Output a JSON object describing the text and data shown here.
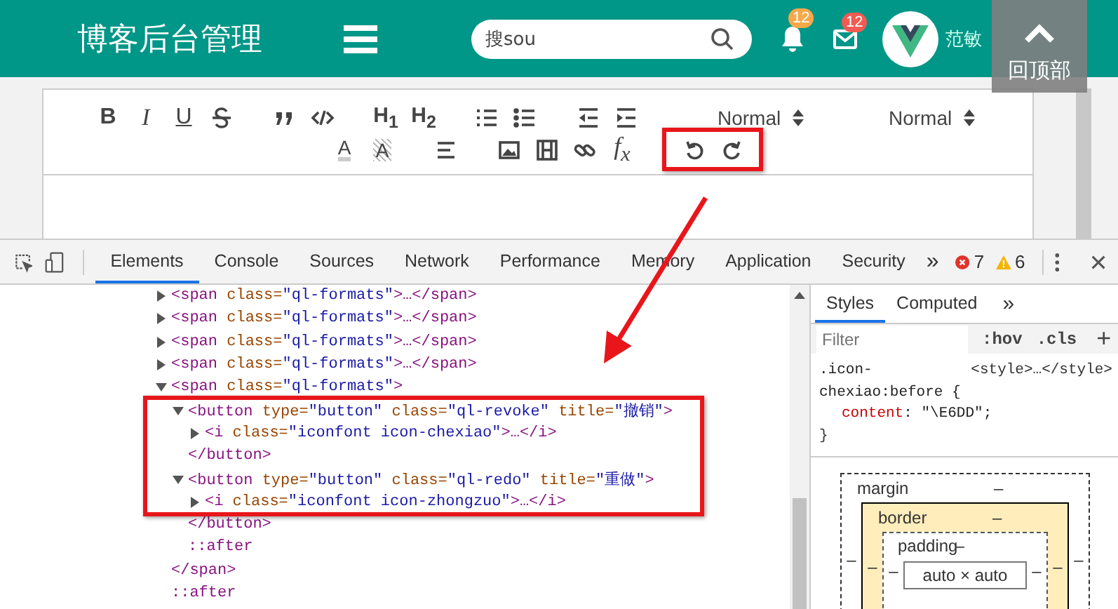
{
  "header": {
    "title": "博客后台管理",
    "search": {
      "value": "搜sou"
    },
    "notifications": [
      {
        "kind": "bell",
        "badge": "12",
        "color": "#f7a84a"
      },
      {
        "kind": "mail",
        "badge": "12",
        "color": "#f05b52"
      }
    ],
    "user_name": "范敏",
    "back_to_top": "回顶部"
  },
  "editor": {
    "toolbar": [
      [
        {
          "highlighted": false,
          "items": [
            {
              "kind": "bold",
              "label": "B"
            },
            {
              "kind": "italic",
              "label": "I"
            },
            {
              "kind": "underline",
              "label": "U"
            },
            {
              "kind": "strike"
            }
          ]
        },
        {
          "highlighted": false,
          "items": [
            {
              "kind": "quote"
            },
            {
              "kind": "code"
            }
          ]
        },
        {
          "highlighted": false,
          "items": [
            {
              "kind": "header",
              "label": "H$_{1}$"
            },
            {
              "kind": "header",
              "label": "H$_{2}$"
            }
          ]
        },
        {
          "highlighted": false,
          "items": [
            {
              "kind": "ordered-list"
            },
            {
              "kind": "bullet-list"
            }
          ]
        },
        {
          "highlighted": false,
          "items": [
            {
              "kind": "outdent"
            },
            {
              "kind": "indent"
            }
          ]
        },
        {
          "highlighted": false,
          "items": [
            {
              "kind": "select",
              "label": "Normal"
            }
          ]
        },
        {
          "highlighted": false,
          "items": [
            {
              "kind": "select",
              "label": "Normal"
            }
          ]
        }
      ],
      [
        {
          "highlighted": false,
          "items": [
            {
              "kind": "color",
              "label": "A"
            },
            {
              "kind": "background",
              "label": "A"
            }
          ]
        },
        {
          "highlighted": false,
          "items": [
            {
              "kind": "align"
            }
          ]
        },
        {
          "highlighted": false,
          "items": [
            {
              "kind": "image"
            },
            {
              "kind": "video"
            },
            {
              "kind": "link"
            },
            {
              "kind": "formula",
              "label": "f$_{x}$"
            }
          ]
        },
        {
          "highlighted": true,
          "items": [
            {
              "kind": "undo"
            },
            {
              "kind": "redo"
            }
          ]
        }
      ]
    ]
  },
  "devtools": {
    "tabs": [
      {
        "label": "Elements",
        "selected": true
      },
      {
        "label": "Console",
        "selected": false
      },
      {
        "label": "Sources",
        "selected": false
      },
      {
        "label": "Network",
        "selected": false
      },
      {
        "label": "Performance",
        "selected": false
      },
      {
        "label": "Memory",
        "selected": false
      },
      {
        "label": "Application",
        "selected": false
      },
      {
        "label": "Security",
        "selected": false
      }
    ],
    "more": "»",
    "errors": "7",
    "warnings": "6",
    "dom_tree": [
      {
        "open": "<span class=\"ql-formats\">…</span>",
        "expanded": false
      },
      {
        "open": "<span class=\"ql-formats\">…</span>",
        "expanded": false
      },
      {
        "open": "<span class=\"ql-formats\">…</span>",
        "expanded": false
      },
      {
        "open": "<span class=\"ql-formats\">…</span>",
        "expanded": false
      },
      {
        "open": "<span class=\"ql-formats\">",
        "expanded": true,
        "close": "</span>",
        "children": [
          {
            "open": "<button type=\"button\" class=\"ql-revoke\" title=\"撤销\">",
            "expanded": true,
            "highlighted": true,
            "close": "</button>",
            "children": [
              {
                "open": "<i class=\"iconfont icon-chexiao\">…</i>",
                "expanded": false
              }
            ]
          },
          {
            "open": "<button type=\"button\" class=\"ql-redo\" title=\"重做\">",
            "expanded": true,
            "highlighted": true,
            "close": "</button>",
            "children": [
              {
                "open": "<i class=\"iconfont icon-zhongzuo\">…</i>",
                "expanded": false
              }
            ]
          },
          {
            "open": "::after"
          }
        ]
      },
      {
        "open": "::after"
      }
    ],
    "styles_pane": {
      "tabs": [
        {
          "label": "Styles",
          "selected": true
        },
        {
          "label": "Computed",
          "selected": false
        }
      ],
      "more": "»",
      "filter": {
        "placeholder": "Filter"
      },
      "hov": ":hov",
      "cls": ".cls",
      "add": "+",
      "rule": {
        "selector": ".icon-chexiao:before {",
        "source": "<style>…</style>",
        "declaration": "content: \"\\E6DD\";",
        "close": "}"
      },
      "box_model": {
        "margin": {
          "label": "margin",
          "top": "–",
          "left": "–",
          "right": "–"
        },
        "border": {
          "label": "border",
          "top": "–",
          "left": "–",
          "right": "–"
        },
        "padding": {
          "label": "padding",
          "top": "–",
          "left": "–",
          "right": "–"
        },
        "content": "auto × auto"
      }
    }
  }
}
